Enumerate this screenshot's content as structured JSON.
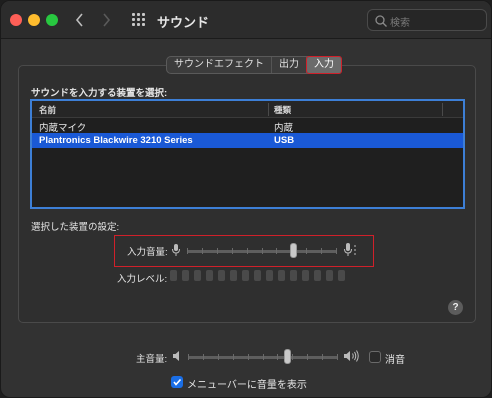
{
  "window": {
    "title": "サウンド"
  },
  "search": {
    "placeholder": "検索"
  },
  "tabs": [
    {
      "label": "サウンドエフェクト",
      "active": false
    },
    {
      "label": "出力",
      "active": false
    },
    {
      "label": "入力",
      "active": true
    }
  ],
  "input": {
    "device_section_label": "サウンドを入力する装置を選択:",
    "table": {
      "columns": [
        "名前",
        "種類"
      ],
      "rows": [
        {
          "name": "内蔵マイク",
          "type": "内蔵",
          "selected": false
        },
        {
          "name": "Plantronics Blackwire 3210 Series",
          "type": "USB",
          "selected": true
        }
      ]
    },
    "settings_label": "選択した装置の設定:",
    "input_volume_label": "入力音量:",
    "input_volume_value": 0.72,
    "input_level_label": "入力レベル:",
    "input_level_segments": 15
  },
  "output": {
    "main_volume_label": "主音量:",
    "main_volume_value": 0.67,
    "mute_label": "消音",
    "mute_checked": false,
    "show_in_menubar_label": "メニューバーに音量を表示",
    "show_in_menubar_checked": true
  },
  "colors": {
    "accent": "#1a59d6",
    "highlight": "#d0202a"
  }
}
